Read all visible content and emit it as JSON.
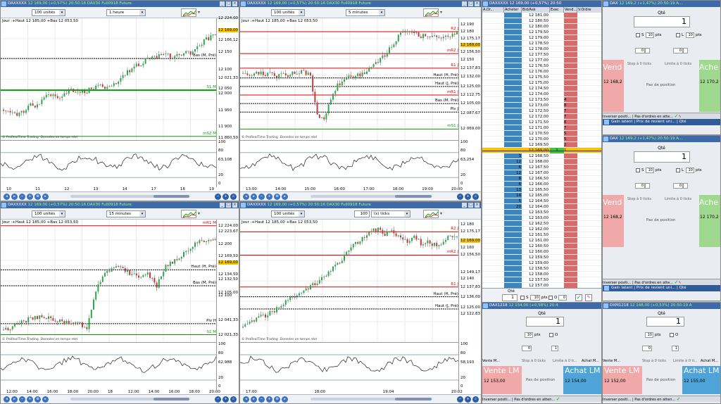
{
  "charts": [
    {
      "id": "c1",
      "title_sym": "DAXXXXX",
      "title_rest": "12 169,00 (+0,57%)  20:50:16 DAX30 Full0918 Future",
      "units": "100 unités",
      "period": "1 heure",
      "info": "Jour :+Haut 12 185,00 +Bas 12 053,50",
      "yticks": [
        "12 224,00",
        "12 169,00",
        "12 166,12",
        "12 150",
        "12 100",
        "12 050",
        "12 021,33",
        "12 000",
        "11 950",
        "11 900",
        "11 860,50"
      ],
      "levels": [
        {
          "label": "S1 M",
          "color": "#0a9a0a"
        },
        {
          "label": "mS2 M",
          "color": "#0a9a0a"
        },
        {
          "label": "Bas (M, Pré)",
          "color": "#000"
        }
      ],
      "xticks": [
        "10",
        "11",
        "12",
        "13",
        "14",
        "17",
        "18",
        "19"
      ],
      "osc": [
        "100",
        "80",
        "63,108",
        "20",
        "0"
      ],
      "vendor": "ProRealTime Trading",
      "note": "Données en temps réel"
    },
    {
      "id": "c2",
      "title_sym": "DAXXXXX",
      "title_rest": "12 169,00 (+0,57%)  20:50:16 DAX30 Full0918 Future",
      "units": "100 unités",
      "period": "5 minutes",
      "info": "Jour :+Haut 12 185,00 +Bas 12 053,50",
      "yticks": [
        "12 190",
        "12 180",
        "12 175,17",
        "12 169,00",
        "12 156,50",
        "12 150",
        "12 137,83",
        "12 132,00",
        "12 125,00",
        "12 112,75",
        "12 105,00",
        "12 087,67",
        "12 069,00"
      ],
      "levels": [
        {
          "label": "R2 J",
          "color": "#d00"
        },
        {
          "label": "mR2 J",
          "color": "#d00"
        },
        {
          "label": "R1 J",
          "color": "#d00"
        },
        {
          "label": "Haut (H, Pré)",
          "color": "#000"
        },
        {
          "label": "Haut (J, Pré)",
          "color": "#000"
        },
        {
          "label": "mR1 J",
          "color": "#d00"
        },
        {
          "label": "Bas (M, Pré)",
          "color": "#000"
        },
        {
          "label": "Piv J",
          "color": "#000"
        },
        {
          "label": "mS1 J",
          "color": "#0a9a0a"
        }
      ],
      "xticks": [
        "13:00",
        "14:00",
        "15:00",
        "16:00",
        "17:00",
        "18:00",
        "19:00",
        "20:00"
      ],
      "osc": [
        "100",
        "80",
        "63,254",
        "20",
        "0"
      ],
      "vendor": "ProRealTime Trading",
      "note": "Données en temps réel"
    },
    {
      "id": "c3",
      "title_sym": "DAXXXXX",
      "title_rest": "12 169,00 (+0,57%)  20:50:16 DAX30 Full0918 Future",
      "units": "100 unités",
      "period": "15 minutes",
      "info": "Jour :+Haut 12 185,00 +Bas 12 053,50",
      "yticks": [
        "12 224,00",
        "12 223,67",
        "12 200",
        "12 169,50",
        "12 169,00",
        "12 134,50",
        "12 132,50",
        "12 105,00",
        "12 100",
        "12 041,33",
        "12 021,33"
      ],
      "levels": [
        {
          "label": "mR1 M",
          "color": "#d00"
        },
        {
          "label": "Haut (H, Pré)",
          "color": "#000"
        },
        {
          "label": "Bas (M, Pré)",
          "color": "#000"
        },
        {
          "label": "Piv H",
          "color": "#000"
        },
        {
          "label": "S1 M",
          "color": "#0a9a0a"
        }
      ],
      "xticks": [
        "12:00",
        "14:00",
        "16:00",
        "18:00",
        "20:00",
        "18",
        "12:00",
        "14:00",
        "16:00",
        "18:00",
        "20:00"
      ],
      "osc": [
        "100",
        "80",
        "62,988",
        "20",
        "0"
      ],
      "vendor": "ProRealTime Trading",
      "note": "Données en temps réel"
    },
    {
      "id": "c4",
      "title_sym": "DAXXXXX",
      "title_rest": "12 169,00 (+0,57%)  20:50:16 DAX30 Full0918 Future",
      "units": "100 unités",
      "period": "(x) ticks",
      "ticks": "100",
      "info": "Jour :+Haut 12 185,00 +Bas 12 053,50",
      "yticks": [
        "12 180",
        "12 175,17",
        "12 169,00",
        "12 160",
        "12 156,50",
        "12 149,17",
        "12 140",
        "12 137,83",
        "12 136,00",
        "12 125,00",
        "12 122,83"
      ],
      "levels": [
        {
          "label": "R2 J",
          "color": "#d00"
        },
        {
          "label": "mR2 J",
          "color": "#d00"
        },
        {
          "label": "R1 J",
          "color": "#d00"
        },
        {
          "label": "Haut (H, Pré)",
          "color": "#000"
        },
        {
          "label": "Haut (J, Pré)",
          "color": "#000"
        }
      ],
      "xticks": [
        "17:00",
        "18:00",
        "19:04",
        "20:02"
      ],
      "osc": [
        "100",
        "80",
        "58,193",
        "20",
        "0"
      ],
      "vendor": "ProRealTime Trading",
      "note": "Données en temps réel"
    }
  ],
  "orderbook": {
    "title": "DAXXXXX",
    "title_rest": "12 169,00 (+0,57%)  20:50",
    "headers": [
      "A.Or...",
      "Acheter",
      "Bid/Ask",
      "Exec",
      "Vend...",
      "V.Ordre"
    ],
    "rows": [
      [
        "",
        "12 181,00",
        ""
      ],
      [
        "",
        "12 180,50",
        ""
      ],
      [
        "",
        "12 180,00",
        ""
      ],
      [
        "",
        "12 179,50",
        ""
      ],
      [
        "",
        "12 179,00",
        ""
      ],
      [
        "",
        "12 178,50",
        ""
      ],
      [
        "",
        "12 178,00",
        ""
      ],
      [
        "",
        "12 177,50",
        ""
      ],
      [
        "",
        "12 177,00",
        ""
      ],
      [
        "",
        "12 176,50",
        ""
      ],
      [
        "",
        "12 176,00",
        ""
      ],
      [
        "",
        "12 175,50",
        ""
      ],
      [
        "",
        "12 175,00",
        ""
      ],
      [
        "",
        "12 174,50",
        ""
      ],
      [
        "",
        "12 174,00",
        ""
      ],
      [
        "",
        "12 173,50",
        "4"
      ],
      [
        "",
        "12 173,00",
        "8"
      ],
      [
        "",
        "12 172,50",
        "7"
      ],
      [
        "",
        "12 172,00",
        "7"
      ],
      [
        "",
        "12 171,50",
        "6"
      ],
      [
        "",
        "12 171,00",
        "7"
      ],
      [
        "",
        "12 170,50",
        "5"
      ],
      [
        "",
        "12 170,00",
        "5"
      ],
      [
        "",
        "12 169,50",
        "2"
      ],
      [
        "",
        "12 169,00",
        "1"
      ],
      [
        "3",
        "12 168,50",
        ""
      ],
      [
        "12",
        "12 168,00",
        ""
      ],
      [
        "6",
        "12 167,50",
        ""
      ],
      [
        "12",
        "12 167,00",
        ""
      ],
      [
        "8",
        "12 166,50",
        ""
      ],
      [
        "6",
        "12 166,00",
        ""
      ],
      [
        "13",
        "12 165,50",
        ""
      ],
      [
        "14",
        "12 165,00",
        ""
      ],
      [
        "5",
        "12 164,50",
        ""
      ],
      [
        "20",
        "12 164,00",
        ""
      ],
      [
        "",
        "12 163,50",
        ""
      ],
      [
        "",
        "12 163,00",
        ""
      ],
      [
        "",
        "12 162,50",
        ""
      ],
      [
        "",
        "12 162,00",
        ""
      ],
      [
        "",
        "12 161,50",
        ""
      ],
      [
        "",
        "12 161,00",
        ""
      ],
      [
        "",
        "12 160,50",
        ""
      ],
      [
        "",
        "12 160,00",
        ""
      ],
      [
        "",
        "12 159,50",
        ""
      ],
      [
        "",
        "12 159,00",
        ""
      ],
      [
        "",
        "12 158,50",
        ""
      ],
      [
        "",
        "12 158,00",
        ""
      ],
      [
        "",
        "12 157,50",
        ""
      ],
      [
        "",
        "12 157,00",
        ""
      ]
    ],
    "exec_qty": "1",
    "qte_label": "Qté",
    "qte_val": "1",
    "s_label": "S",
    "pts": "10",
    "pts_label": "pts",
    "o_label": "O",
    "s_pts": "0"
  },
  "trade": [
    {
      "id": "t1",
      "sym": "DAX",
      "rest": "12 169,2 (+1,47%)  20:50:19 A...",
      "qte_label": "Qté",
      "qte": "1",
      "s_label": "S",
      "s_val": "10",
      "l_label": "L",
      "l_val": "10",
      "pts": "pts",
      "spin1": "0",
      "spin2": "0",
      "vend": "Vend",
      "ache": "Ache",
      "bid": "12 168,2",
      "ask": "12 170,2",
      "stop": "Stop à 0 ticks",
      "limit": "Limite à 0 ticks",
      "pos": "Pas de position",
      "inv": "Inverser positi...",
      "cancel": "Pas d'ordres en atte...",
      "gain": "Gain latent",
      "prix": "Prix de revient uni...",
      "qte2": "Qté"
    },
    {
      "id": "t2",
      "sym": "DAX",
      "rest": "12 169,2 (+1,47%)  20:50:19 A...",
      "qte_label": "Qté",
      "qte": "1",
      "s_label": "S",
      "s_val": "10",
      "l_label": "L",
      "l_val": "10",
      "pts": "pts",
      "spin1": "0",
      "spin2": "0",
      "vend": "Vend",
      "ache": "Ache",
      "bid": "12 168,2",
      "ask": "12 170,2",
      "stop": "Stop à 0 ticks",
      "limit": "Limite à 0 ticks",
      "pos": "Pas de position",
      "inv": "Inverser positi...",
      "cancel": "Pas d'ordres en atte...",
      "gain": "Gain latent",
      "prix": "Prix de revient uni...",
      "qte2": "Qté"
    }
  ],
  "mini": [
    {
      "sym": "DAX1218",
      "rest": "12 154,00 (+0,58%)  20:4",
      "qte_label": "Qté",
      "qte": "1",
      "pts_val": "10",
      "pts": "pts",
      "o_label": "O",
      "spin1": "0",
      "spin2": "1",
      "stop": "Stop à 0 ticks",
      "limit": "Limite à 0 ti...",
      "vente_small": "Vente M...",
      "achat_small": "Achat M...",
      "vente": "Vente LM",
      "achat": "Achat LM",
      "bid": "12 153,00",
      "ask": "12 154,00",
      "pos": "Pas de position",
      "inv": "Inverser positi...",
      "cancel": "Pas d'ordres en atten..."
    },
    {
      "sym": "DXM1218",
      "rest": "12 148,00 (+0,53%)  20:50:19 A",
      "qte_label": "Qté",
      "qte": "1",
      "pts_val": "10",
      "pts": "pts",
      "o_label": "O",
      "spin1": "0",
      "spin2": "1",
      "stop": "Stop à 0 ticks",
      "limit": "Limite à 0 ti...",
      "vente_small": "Vente M...",
      "achat_small": "Achat M...",
      "vente": "Vente LM",
      "achat": "Achat LM",
      "bid": "12 152,00",
      "ask": "12 155,00",
      "pos": "Pas de position",
      "inv": "Inverser positi...",
      "cancel": "Pas d'ordres en atten..."
    }
  ]
}
